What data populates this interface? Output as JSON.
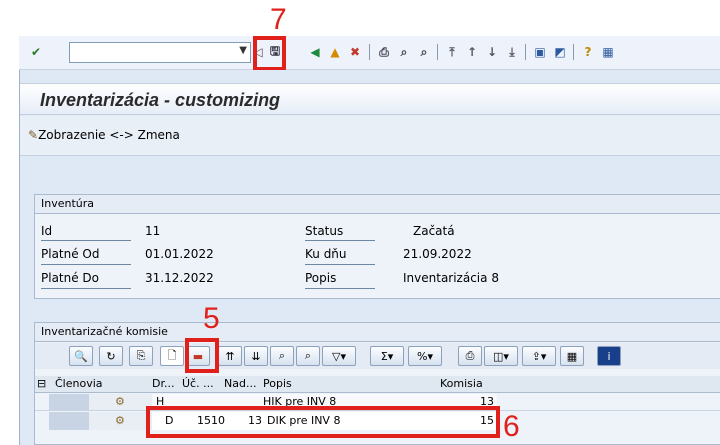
{
  "annotations": {
    "save": "7",
    "create": "5",
    "row": "6"
  },
  "title": "Inventarizácia - customizing",
  "toggle_label": "Zobrazenie <-> Zmena",
  "header_box": {
    "title": "Inventúra",
    "fields": {
      "id_label": "Id",
      "id_value": "11",
      "status_label": "Status",
      "status_value": "Začatá",
      "od_label": "Platné Od",
      "od_value": "01.01.2022",
      "kudnu_label": "Ku dňu",
      "kudnu_value": "21.09.2022",
      "do_label": "Platné Do",
      "do_value": "31.12.2022",
      "popis_label": "Popis",
      "popis_value": "Inventarizácia 8"
    }
  },
  "commission_box": {
    "title": "Inventarizačné komisie",
    "columns": [
      "Členovia",
      "Dr...",
      "Úč. ...",
      "Nad...",
      "Popis",
      "Komisia"
    ],
    "rows": [
      {
        "dr": "H",
        "uc": "",
        "nad": "",
        "popis": "HIK pre INV 8",
        "komisia": "13"
      },
      {
        "dr": "D",
        "uc": "1510",
        "nad": "13",
        "popis": "DIK pre INV 8",
        "komisia": "15"
      }
    ]
  },
  "colors": {
    "annotation": "#e0201a",
    "toolbar_bg": "#eef3fb",
    "panel_bg": "#dfe9f5"
  }
}
